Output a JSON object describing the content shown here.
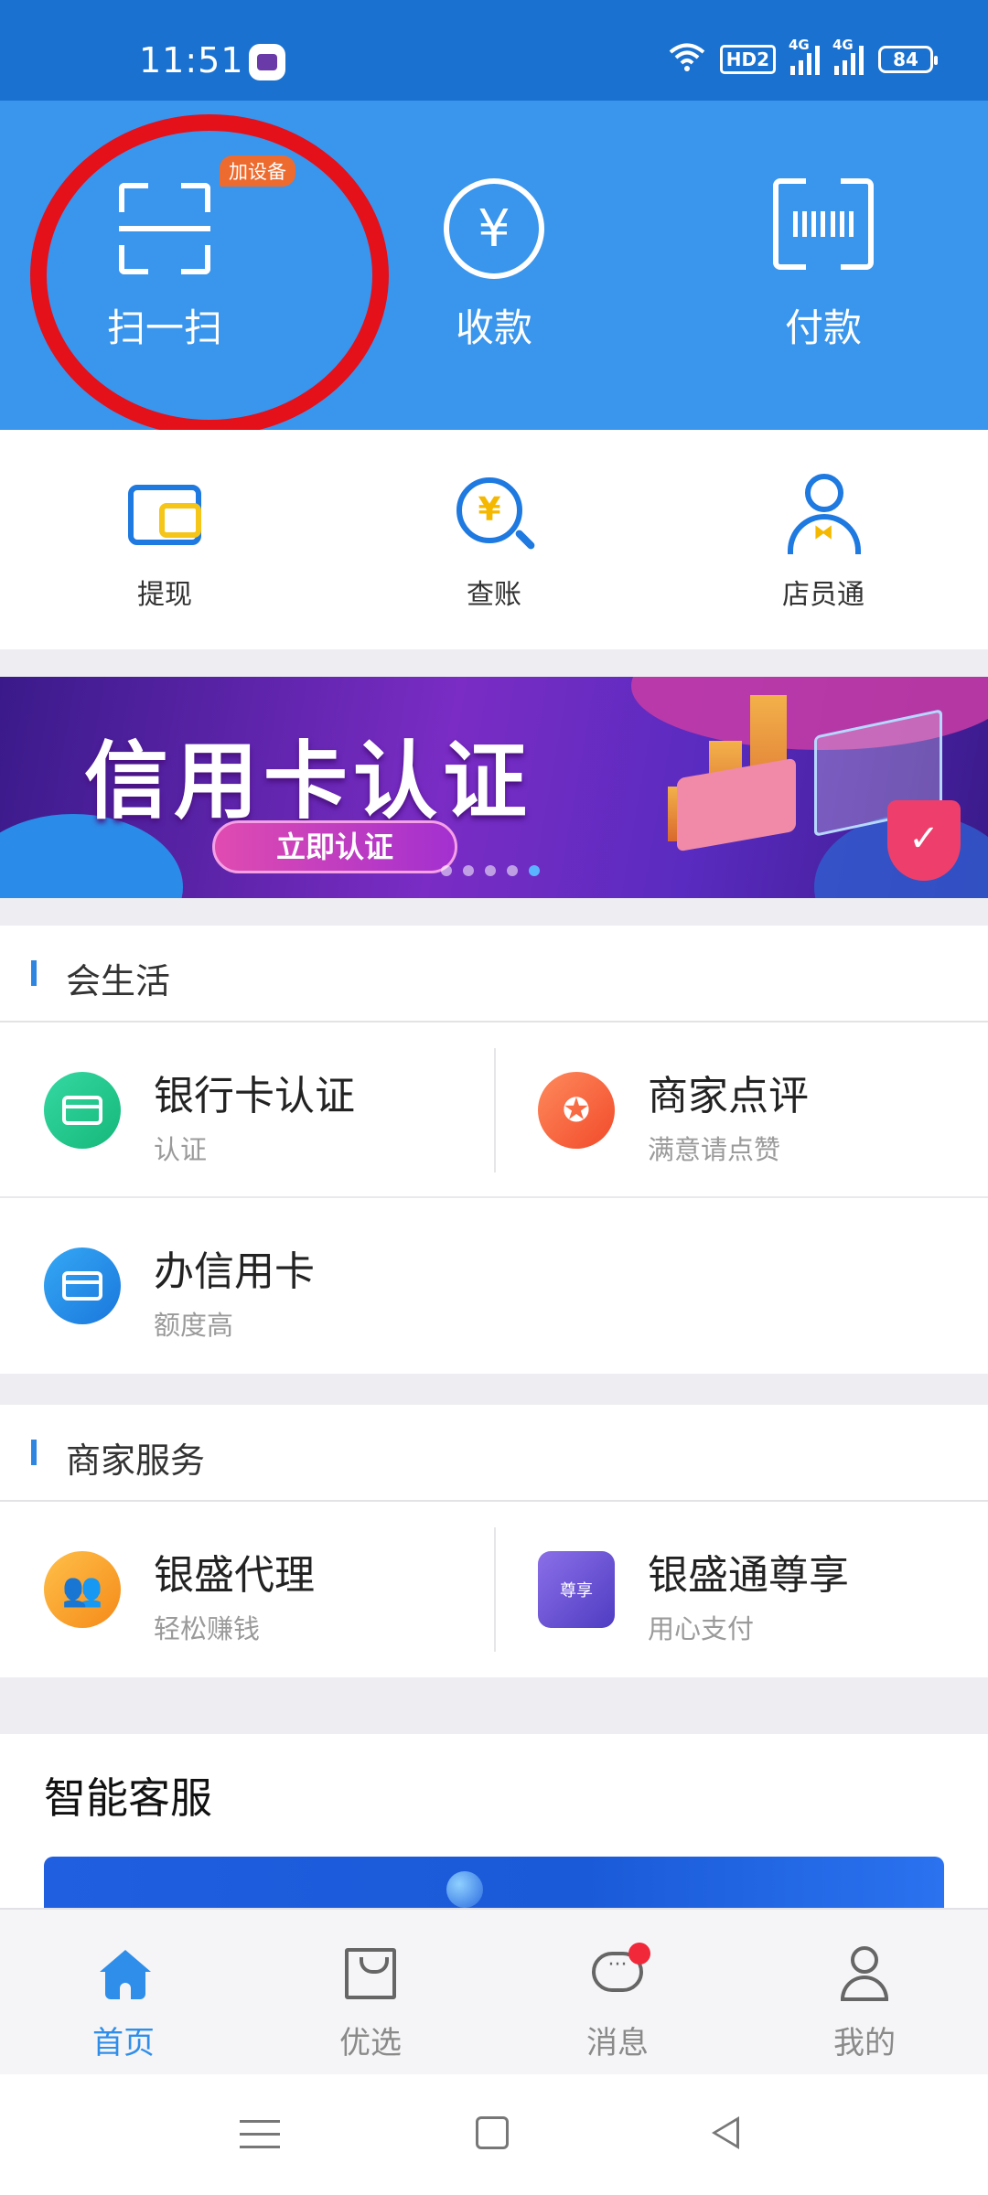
{
  "status_bar": {
    "time": "11:51",
    "network_hd": "HD2",
    "signal1": "4G",
    "signal2": "4G",
    "battery": "84"
  },
  "top_actions": [
    {
      "label": "扫一扫",
      "icon": "scan-icon",
      "badge": "加设备"
    },
    {
      "label": "收款",
      "icon": "yuan-icon",
      "glyph": "¥"
    },
    {
      "label": "付款",
      "icon": "barcode-icon"
    }
  ],
  "tools": [
    {
      "label": "提现",
      "icon": "wallet-icon"
    },
    {
      "label": "查账",
      "icon": "search-yuan-icon",
      "glyph": "¥"
    },
    {
      "label": "店员通",
      "icon": "staff-icon"
    }
  ],
  "banner": {
    "title": "信用卡认证",
    "cta": "立即认证",
    "dots_total": 5,
    "active_dot": 5
  },
  "sections": {
    "life": {
      "title": "会生活",
      "items": [
        {
          "name": "银行卡认证",
          "sub": "认证",
          "icon": "bank-card-icon",
          "color": "#1fc48a"
        },
        {
          "name": "商家点评",
          "sub": "满意请点赞",
          "icon": "award-icon",
          "color": "#f35a35"
        },
        {
          "name": "办信用卡",
          "sub": "额度高",
          "icon": "credit-card-icon",
          "color": "#2185e6"
        }
      ]
    },
    "merchant": {
      "title": "商家服务",
      "items": [
        {
          "name": "银盛代理",
          "sub": "轻松赚钱",
          "icon": "group-icon",
          "color": "#f8a23a"
        },
        {
          "name": "银盛通尊享",
          "sub": "用心支付",
          "icon": "vip-badge-icon",
          "badge_text": "尊享",
          "color": "#6a55d8"
        }
      ]
    }
  },
  "smart_service": {
    "title": "智能客服"
  },
  "tabbar": [
    {
      "label": "首页",
      "icon": "home-icon",
      "active": true
    },
    {
      "label": "优选",
      "icon": "shopping-bag-icon",
      "active": false
    },
    {
      "label": "消息",
      "icon": "chat-bubble-icon",
      "active": false,
      "dot": true
    },
    {
      "label": "我的",
      "icon": "profile-icon",
      "active": false
    }
  ],
  "colors": {
    "primary": "#3a95ec",
    "status_bar": "#1a71d0",
    "active_tab": "#2f8eea",
    "highlight_circle": "#e4101a"
  }
}
